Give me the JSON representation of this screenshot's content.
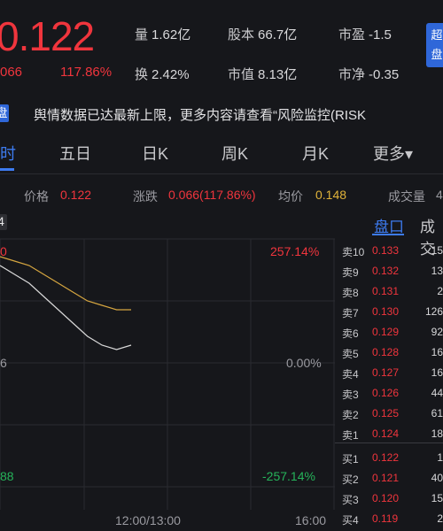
{
  "header": {
    "price": "0.122",
    "change": "066",
    "change_pct": "117.86%",
    "badge": "超\n盘",
    "stats": [
      {
        "label": "量",
        "value": "1.62亿"
      },
      {
        "label": "股本",
        "value": "66.7亿"
      },
      {
        "label": "市盈",
        "value": "-1.5"
      },
      {
        "label": "换",
        "value": "2.42%"
      },
      {
        "label": "市值",
        "value": "8.13亿"
      },
      {
        "label": "市净",
        "value": "-0.35"
      }
    ]
  },
  "notice": {
    "tag": "盘",
    "text": "舆情数据已达最新上限，更多内容请查看“风险监控(RISK"
  },
  "tabs": [
    "时",
    "五日",
    "日K",
    "周K",
    "月K",
    "更多▾"
  ],
  "info": {
    "price_label": "价格",
    "price_value": "0.122",
    "change_label": "涨跌",
    "change_value": "0.066(117.86%)",
    "avg_label": "均价",
    "avg_value": "0.148",
    "volume_label": "成交量",
    "volume_value": "4"
  },
  "chart": {
    "top_left": "0",
    "top_right": "257.14%",
    "mid_left": "6",
    "mid_right": "0.00%",
    "bottom_left": "88",
    "bottom_right": "-257.14%",
    "x_mid": "12:00/13:00",
    "x_end": "16:00",
    "tag_left": "4"
  },
  "chart_data": {
    "type": "line",
    "x_labels": [
      "12:00/13:00",
      "16:00"
    ],
    "y_right_labels": [
      "257.14%",
      "0.00%",
      "-257.14%"
    ],
    "series": [
      {
        "values": [
          0.14,
          0.138,
          0.136,
          0.133,
          0.13,
          0.127,
          0.124,
          0.122,
          0.121,
          0.122
        ]
      },
      {
        "values": [
          0.142,
          0.141,
          0.14,
          0.138,
          0.136,
          0.134,
          0.132,
          0.131,
          0.13,
          0.13
        ]
      }
    ],
    "colors": {
      "price": "#d9d9d9",
      "average": "#d6a640"
    }
  },
  "orderbook": {
    "tabs": [
      "盘口",
      "成交"
    ],
    "asks": [
      {
        "label": "卖10",
        "price": "0.133",
        "vol": "15"
      },
      {
        "label": "卖9",
        "price": "0.132",
        "vol": "13"
      },
      {
        "label": "卖8",
        "price": "0.131",
        "vol": "2"
      },
      {
        "label": "卖7",
        "price": "0.130",
        "vol": "126"
      },
      {
        "label": "卖6",
        "price": "0.129",
        "vol": "92"
      },
      {
        "label": "卖5",
        "price": "0.128",
        "vol": "16"
      },
      {
        "label": "卖4",
        "price": "0.127",
        "vol": "16"
      },
      {
        "label": "卖3",
        "price": "0.126",
        "vol": "44"
      },
      {
        "label": "卖2",
        "price": "0.125",
        "vol": "61"
      },
      {
        "label": "卖1",
        "price": "0.124",
        "vol": "18"
      }
    ],
    "bids": [
      {
        "label": "买1",
        "price": "0.122",
        "vol": "1"
      },
      {
        "label": "买2",
        "price": "0.121",
        "vol": "40"
      },
      {
        "label": "买3",
        "price": "0.120",
        "vol": "15"
      },
      {
        "label": "买4",
        "price": "0.119",
        "vol": "2"
      }
    ]
  }
}
